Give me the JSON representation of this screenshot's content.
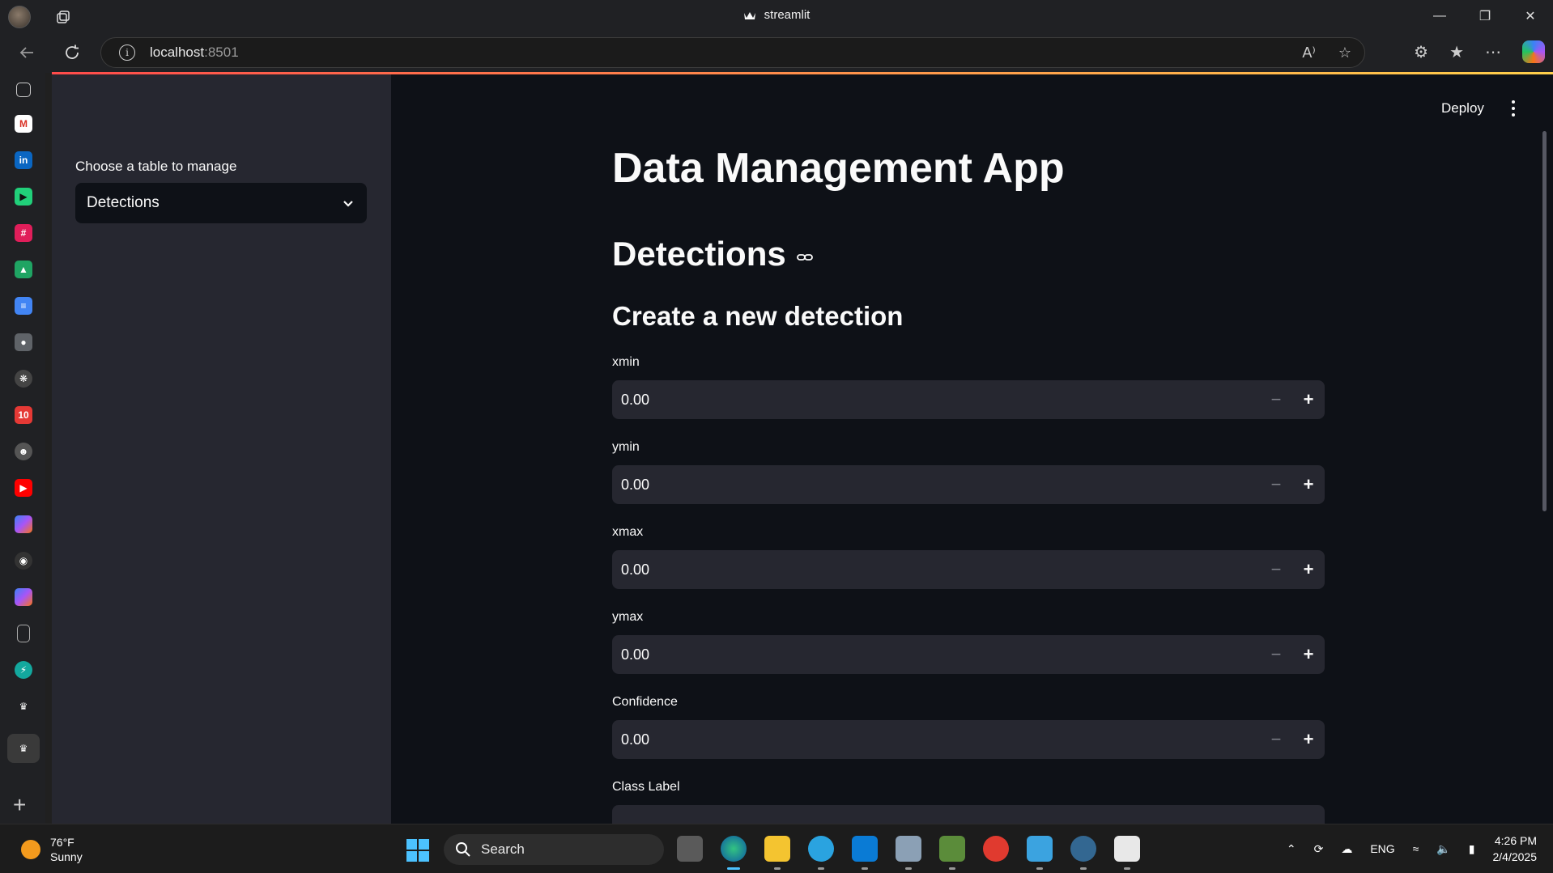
{
  "browser": {
    "window_title": "streamlit",
    "url_host": "localhost",
    "url_port": ":8501"
  },
  "sidebar": {
    "select_label": "Choose a table to manage",
    "select_value": "Detections"
  },
  "header": {
    "deploy_label": "Deploy"
  },
  "main": {
    "title": "Data Management App",
    "section_title": "Detections",
    "subsection_title": "Create a new detection",
    "fields": [
      {
        "label": "xmin",
        "value": "0.00"
      },
      {
        "label": "ymin",
        "value": "0.00"
      },
      {
        "label": "xmax",
        "value": "0.00"
      },
      {
        "label": "ymax",
        "value": "0.00"
      },
      {
        "label": "Confidence",
        "value": "0.00"
      },
      {
        "label": "Class Label",
        "value": ""
      }
    ],
    "stepper_minus": "−",
    "stepper_plus": "+"
  },
  "taskbar": {
    "temperature": "76°F",
    "condition": "Sunny",
    "search_placeholder": "Search",
    "language": "ENG",
    "time": "4:26 PM",
    "date": "2/4/2025"
  },
  "colors": {
    "app_bg": "#0e1117",
    "sidebar_bg": "#262730",
    "input_bg": "#262730",
    "accent_gradient": [
      "#ff4b4b",
      "#ffd04b"
    ]
  }
}
